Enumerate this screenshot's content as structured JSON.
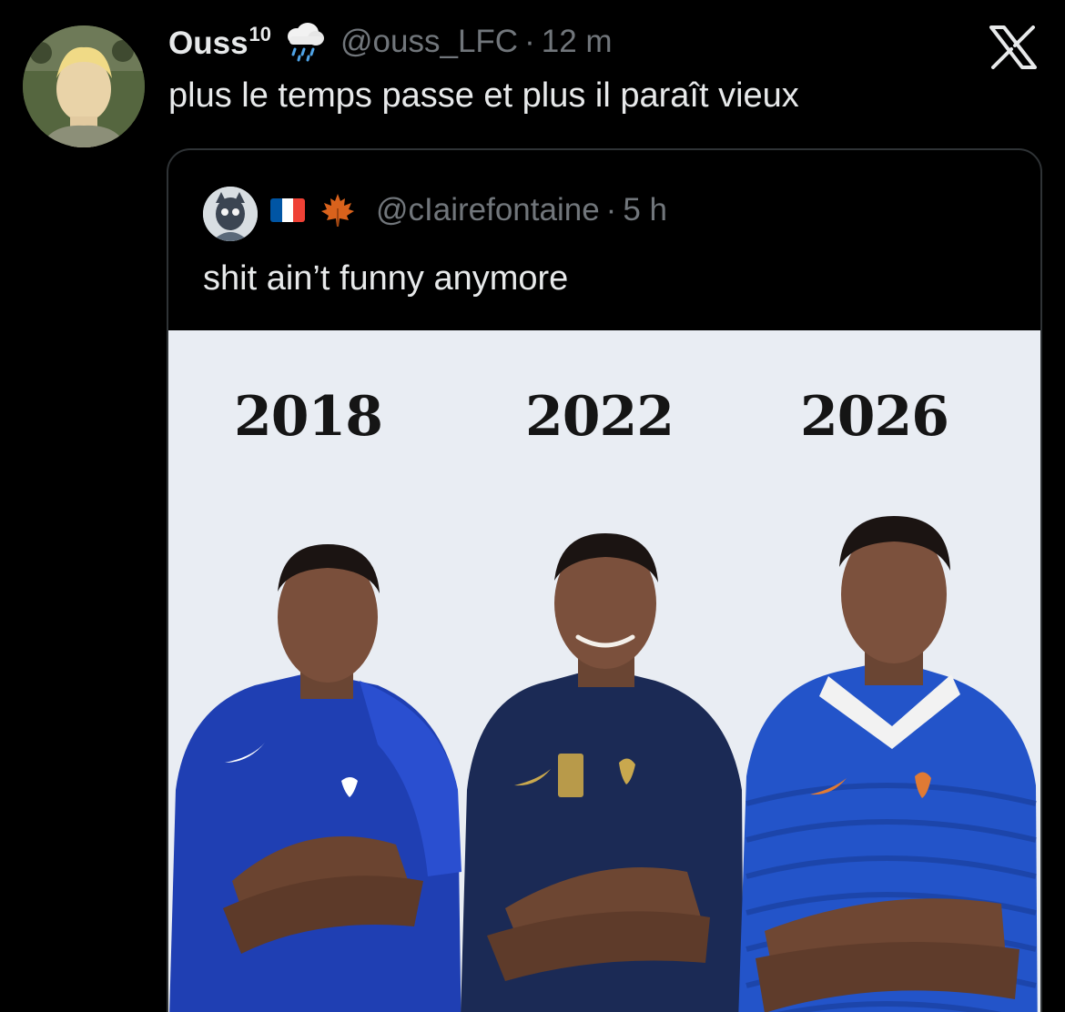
{
  "tweet": {
    "display_name": "Ouss",
    "display_name_sup": "10",
    "handle": "@ouss_LFC",
    "separator": "·",
    "time": "12 m",
    "text": "plus le temps passe et plus il paraît vieux",
    "icons": {
      "weather_emoji": "cloud-with-rain-icon",
      "logo": "x-logo-icon"
    }
  },
  "quote": {
    "handle": "@cIairefontaine",
    "separator": "·",
    "time": "5 h",
    "text": "shit ain’t funny anymore",
    "icons": {
      "flag": "france-flag-icon",
      "leaf": "maple-leaf-icon"
    }
  },
  "media": {
    "years": [
      "2018",
      "2022",
      "2026"
    ],
    "colors": {
      "background": "#e9edf3",
      "jersey_2018": "#1f3fb3",
      "jersey_2022": "#1b2a55",
      "jersey_2026": "#2354c9"
    }
  },
  "colors": {
    "background": "#000000",
    "text_primary": "#e7e9ea",
    "text_secondary": "#71767b",
    "border": "#2f3336"
  }
}
